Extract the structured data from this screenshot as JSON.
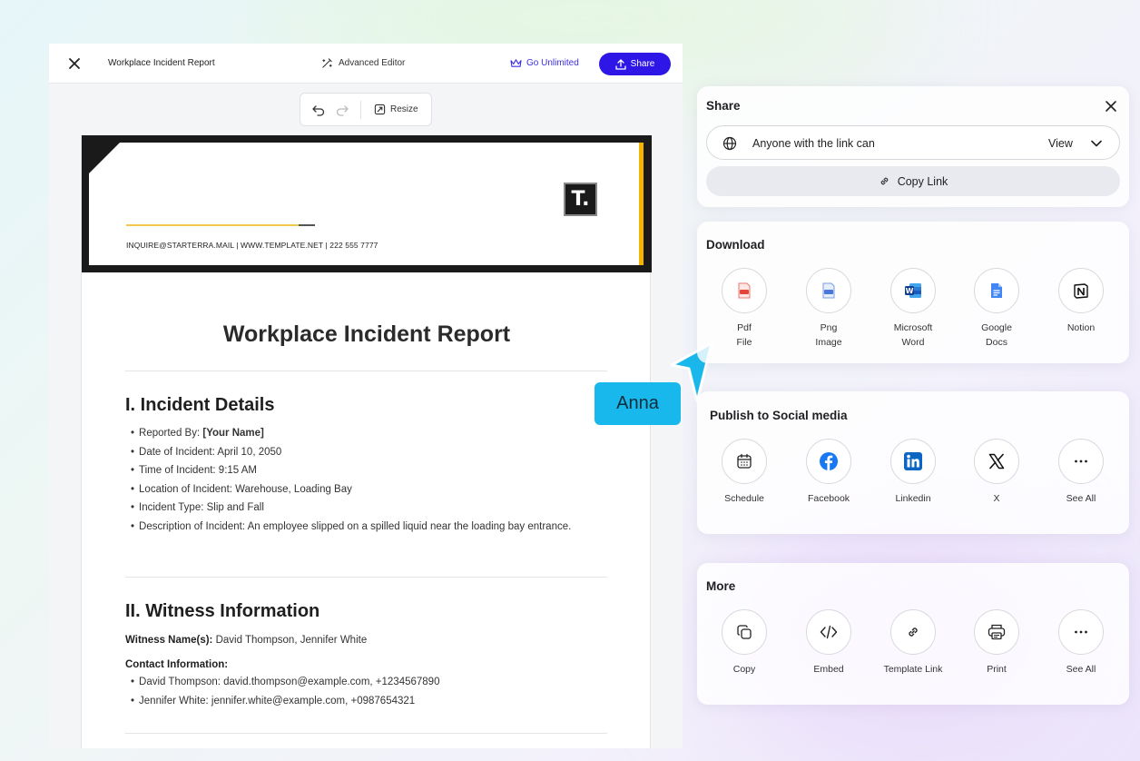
{
  "editor": {
    "document_name": "Workplace Incident Report",
    "advanced_editor": "Advanced Editor",
    "go_unlimited": "Go Unlimited",
    "share": "Share",
    "resize": "Resize"
  },
  "document": {
    "contact_line": "INQUIRE@STARTERRA.MAIL | WWW.TEMPLATE.NET | 222 555 7777",
    "logo_letter": "T.",
    "title": "Workplace Incident Report",
    "section1": {
      "heading": "I. Incident Details",
      "reported_by_label": "Reported By: ",
      "reported_by_value": "[Your Name]",
      "items": [
        "Date of Incident: April 10, 2050",
        "Time of Incident: 9:15 AM",
        "Location of Incident: Warehouse, Loading Bay",
        "Incident Type: Slip and Fall",
        "Description of Incident: An employee slipped on a spilled liquid near the loading bay entrance."
      ]
    },
    "section2": {
      "heading": "II. Witness Information",
      "witness_label": "Witness Name(s):",
      "witness_value": " David Thompson, Jennifer White",
      "contact_label": "Contact Information:",
      "contacts": [
        "David Thompson: david.thompson@example.com, +1234567890",
        "Jennifer White: jennifer.white@example.com, +0987654321"
      ]
    }
  },
  "cursor": {
    "name": "Anna",
    "color": "#19b8ec"
  },
  "share_panel": {
    "title": "Share",
    "link_access": "Anyone with the link can",
    "permission": "View",
    "copy_link": "Copy Link"
  },
  "download_panel": {
    "title": "Download",
    "items": [
      {
        "label": "Pdf\nFile",
        "icon": "pdf-file-icon"
      },
      {
        "label": "Png\nImage",
        "icon": "png-image-icon"
      },
      {
        "label": "Microsoft\nWord",
        "icon": "microsoft-word-icon"
      },
      {
        "label": "Google\nDocs",
        "icon": "google-docs-icon"
      },
      {
        "label": "Notion",
        "icon": "notion-icon"
      }
    ]
  },
  "social_panel": {
    "title": "Publish to Social media",
    "items": [
      {
        "label": "Schedule",
        "icon": "calendar-icon"
      },
      {
        "label": "Facebook",
        "icon": "facebook-icon"
      },
      {
        "label": "Linkedin",
        "icon": "linkedin-icon"
      },
      {
        "label": "X",
        "icon": "x-icon"
      },
      {
        "label": "See All",
        "icon": "more-icon"
      }
    ]
  },
  "more_panel": {
    "title": "More",
    "items": [
      {
        "label": "Copy",
        "icon": "copy-icon"
      },
      {
        "label": "Embed",
        "icon": "embed-icon"
      },
      {
        "label": "Template Link",
        "icon": "link-icon"
      },
      {
        "label": "Print",
        "icon": "print-icon"
      },
      {
        "label": "See All",
        "icon": "more-icon"
      }
    ]
  },
  "colors": {
    "brand": "#2e16e6",
    "doc_accent": "#f4b400",
    "header_dark": "#1a1a1a"
  }
}
